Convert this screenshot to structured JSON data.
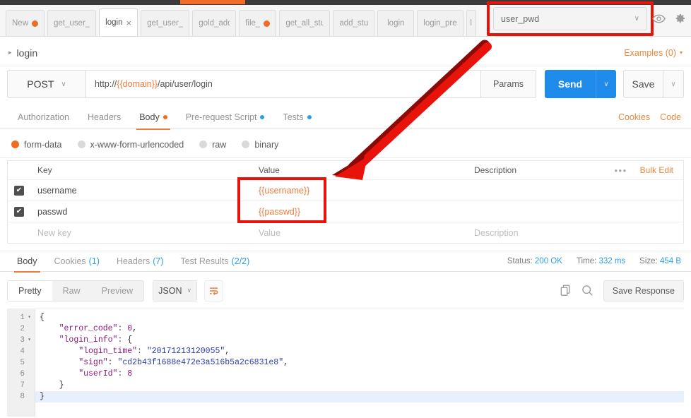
{
  "window": {
    "accent_orange": "#f07c3c",
    "highlight_red": "#e8140c",
    "send_blue": "#1f8ceb"
  },
  "tabbar": {
    "tabs": [
      {
        "label": "New",
        "dot": "orange",
        "closable": false,
        "active": false
      },
      {
        "label": "get_user_",
        "dot": null,
        "closable": false,
        "active": false
      },
      {
        "label": "login",
        "dot": null,
        "closable": true,
        "active": true
      },
      {
        "label": "get_user_",
        "dot": null,
        "closable": false,
        "active": false
      },
      {
        "label": "gold_add",
        "dot": null,
        "closable": false,
        "active": false
      },
      {
        "label": "file_",
        "dot": "orange",
        "closable": false,
        "active": false
      },
      {
        "label": "get_all_stu",
        "dot": null,
        "closable": false,
        "active": false
      },
      {
        "label": "add_stu",
        "dot": null,
        "closable": false,
        "active": false
      },
      {
        "label": "login",
        "dot": null,
        "closable": false,
        "active": false
      },
      {
        "label": "login_pre",
        "dot": null,
        "closable": false,
        "active": false
      },
      {
        "label": "l",
        "dot": null,
        "closable": false,
        "active": false
      }
    ],
    "close_glyph": "×"
  },
  "environment": {
    "selected": "user_pwd",
    "caret": "∨",
    "eye_icon": "eye-icon",
    "gear_icon": "gear-icon"
  },
  "request_header": {
    "arrow": "▸",
    "name": "login",
    "examples_label": "Examples (0)",
    "examples_caret": "▾"
  },
  "urlbar": {
    "method": "POST",
    "method_caret": "∨",
    "url_prefix": "http://",
    "url_variable": "{{domain}}",
    "url_suffix": "/api/user/login",
    "params_label": "Params",
    "send_label": "Send",
    "send_caret": "∨",
    "save_label": "Save",
    "save_caret": "∨"
  },
  "request_tabs": {
    "items": [
      {
        "label": "Authorization",
        "dot": null,
        "active": false
      },
      {
        "label": "Headers",
        "dot": null,
        "active": false
      },
      {
        "label": "Body",
        "dot": "orange",
        "active": true
      },
      {
        "label": "Pre-request Script",
        "dot": "blue",
        "active": false
      },
      {
        "label": "Tests",
        "dot": "blue",
        "active": false
      }
    ],
    "cookies_label": "Cookies",
    "code_label": "Code"
  },
  "body_types": {
    "options": [
      {
        "label": "form-data",
        "selected": true
      },
      {
        "label": "x-www-form-urlencoded",
        "selected": false
      },
      {
        "label": "raw",
        "selected": false
      },
      {
        "label": "binary",
        "selected": false
      }
    ]
  },
  "kv_table": {
    "headers": {
      "key": "Key",
      "value": "Value",
      "description": "Description"
    },
    "dots": "•••",
    "bulk_edit": "Bulk Edit",
    "check_glyph": "✔",
    "rows": [
      {
        "checked": true,
        "key": "username",
        "value": "{{username}}",
        "description": ""
      },
      {
        "checked": true,
        "key": "passwd",
        "value": "{{passwd}}",
        "description": ""
      }
    ],
    "new_row": {
      "key": "New key",
      "value": "Value",
      "description": "Description"
    }
  },
  "response_tabs": {
    "items": [
      {
        "label": "Body",
        "count": "",
        "active": true
      },
      {
        "label": "Cookies",
        "count": "(1)",
        "active": false
      },
      {
        "label": "Headers",
        "count": "(7)",
        "active": false
      },
      {
        "label": "Test Results",
        "count": "(2/2)",
        "active": false
      }
    ],
    "status_label": "Status:",
    "status_value": "200 OK",
    "time_label": "Time:",
    "time_value": "332 ms",
    "size_label": "Size:",
    "size_value": "454 B"
  },
  "response_toolbar": {
    "view_modes": [
      {
        "label": "Pretty",
        "active": true
      },
      {
        "label": "Raw",
        "active": false
      },
      {
        "label": "Preview",
        "active": false
      }
    ],
    "format": "JSON",
    "format_caret": "∨",
    "wrap_icon": "word-wrap-icon",
    "copy_icon": "copy-icon",
    "search_icon": "search-icon",
    "save_response_label": "Save Response"
  },
  "response_body": {
    "language": "json",
    "lines": [
      {
        "number": "1",
        "foldable": true,
        "text": "{"
      },
      {
        "number": "2",
        "foldable": false,
        "text": "    \"error_code\": 0,"
      },
      {
        "number": "3",
        "foldable": true,
        "text": "    \"login_info\": {"
      },
      {
        "number": "4",
        "foldable": false,
        "text": "        \"login_time\": \"20171213120055\","
      },
      {
        "number": "5",
        "foldable": false,
        "text": "        \"sign\": \"cd2b43f1688e472e3a516b5a2c6831e8\","
      },
      {
        "number": "6",
        "foldable": false,
        "text": "        \"userId\": 8"
      },
      {
        "number": "7",
        "foldable": false,
        "text": "    }"
      },
      {
        "number": "8",
        "foldable": false,
        "text": "}"
      }
    ],
    "highlighted_line": 8,
    "fold_glyph": "▾",
    "parsed": {
      "error_code": 0,
      "login_info": {
        "login_time": "20171213120055",
        "sign": "cd2b43f1688e472e3a516b5a2c6831e8",
        "userId": 8
      }
    }
  },
  "annotations": {
    "arrow_color": "#e8140c",
    "arrow_from": "environment-selector",
    "arrow_to": "value-column-highlight",
    "highlight_boxes": [
      "environment-selector",
      "value-column-cells"
    ]
  }
}
